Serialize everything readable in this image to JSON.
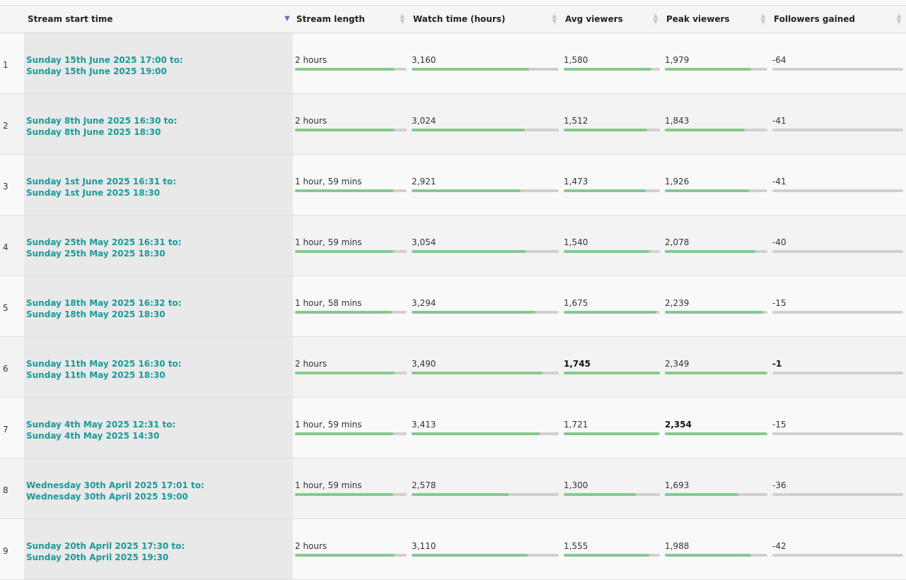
{
  "columns": [
    {
      "key": "num",
      "label": ""
    },
    {
      "key": "start",
      "label": "Stream start time",
      "sorted": true
    },
    {
      "key": "length",
      "label": "Stream length"
    },
    {
      "key": "watch",
      "label": "Watch time (hours)"
    },
    {
      "key": "avg",
      "label": "Avg viewers"
    },
    {
      "key": "peak",
      "label": "Peak viewers"
    },
    {
      "key": "followers",
      "label": "Followers gained"
    }
  ],
  "colors": {
    "link": "#1a9a9a",
    "bar_fill": "#86c98e",
    "bar_track": "#d0d0d0",
    "sort_active": "#6d6fb5"
  },
  "rows": [
    {
      "num": "1",
      "start_line1": "Sunday 15th June 2025 17:00 to:",
      "start_line2": "Sunday 15th June 2025 19:00",
      "length": "2 hours",
      "length_frac": 0.89,
      "watch": "3,160",
      "watch_frac": 0.8,
      "avg": "1,580",
      "avg_frac": 0.91,
      "peak": "1,979",
      "peak_frac": 0.84,
      "followers": "-64",
      "followers_frac": 0
    },
    {
      "num": "2",
      "start_line1": "Sunday 8th June 2025 16:30 to:",
      "start_line2": "Sunday 8th June 2025 18:30",
      "length": "2 hours",
      "length_frac": 0.89,
      "watch": "3,024",
      "watch_frac": 0.77,
      "avg": "1,512",
      "avg_frac": 0.87,
      "peak": "1,843",
      "peak_frac": 0.78,
      "followers": "-41",
      "followers_frac": 0
    },
    {
      "num": "3",
      "start_line1": "Sunday 1st June 2025 16:31 to:",
      "start_line2": "Sunday 1st June 2025 18:30",
      "length": "1 hour, 59 mins",
      "length_frac": 0.88,
      "watch": "2,921",
      "watch_frac": 0.74,
      "avg": "1,473",
      "avg_frac": 0.85,
      "peak": "1,926",
      "peak_frac": 0.82,
      "followers": "-41",
      "followers_frac": 0
    },
    {
      "num": "4",
      "start_line1": "Sunday 25th May 2025 16:31 to:",
      "start_line2": "Sunday 25th May 2025 18:30",
      "length": "1 hour, 59 mins",
      "length_frac": 0.88,
      "watch": "3,054",
      "watch_frac": 0.78,
      "avg": "1,540",
      "avg_frac": 0.89,
      "peak": "2,078",
      "peak_frac": 0.88,
      "followers": "-40",
      "followers_frac": 0
    },
    {
      "num": "5",
      "start_line1": "Sunday 18th May 2025 16:32 to:",
      "start_line2": "Sunday 18th May 2025 18:30",
      "length": "1 hour, 58 mins",
      "length_frac": 0.87,
      "watch": "3,294",
      "watch_frac": 0.84,
      "avg": "1,675",
      "avg_frac": 0.96,
      "peak": "2,239",
      "peak_frac": 0.95,
      "followers": "-15",
      "followers_frac": 0
    },
    {
      "num": "6",
      "start_line1": "Sunday 11th May 2025 16:30 to:",
      "start_line2": "Sunday 11th May 2025 18:30",
      "length": "2 hours",
      "length_frac": 0.89,
      "watch": "3,490",
      "watch_frac": 0.89,
      "avg": "1,745",
      "avg_frac": 1.0,
      "avg_bold": true,
      "peak": "2,349",
      "peak_frac": 1.0,
      "followers": "-1",
      "followers_frac": 0,
      "followers_bold": true
    },
    {
      "num": "7",
      "start_line1": "Sunday 4th May 2025 12:31 to:",
      "start_line2": "Sunday 4th May 2025 14:30",
      "length": "1 hour, 59 mins",
      "length_frac": 0.88,
      "watch": "3,413",
      "watch_frac": 0.87,
      "avg": "1,721",
      "avg_frac": 0.99,
      "peak": "2,354",
      "peak_frac": 1.0,
      "peak_bold": true,
      "followers": "-15",
      "followers_frac": 0
    },
    {
      "num": "8",
      "start_line1": "Wednesday 30th April 2025 17:01 to:",
      "start_line2": "Wednesday 30th April 2025 19:00",
      "length": "1 hour, 59 mins",
      "length_frac": 0.88,
      "watch": "2,578",
      "watch_frac": 0.66,
      "avg": "1,300",
      "avg_frac": 0.75,
      "peak": "1,693",
      "peak_frac": 0.72,
      "followers": "-36",
      "followers_frac": 0
    },
    {
      "num": "9",
      "start_line1": "Sunday 20th April 2025 17:30 to:",
      "start_line2": "Sunday 20th April 2025 19:30",
      "length": "2 hours",
      "length_frac": 0.89,
      "watch": "3,110",
      "watch_frac": 0.79,
      "avg": "1,555",
      "avg_frac": 0.89,
      "peak": "1,988",
      "peak_frac": 0.84,
      "followers": "-42",
      "followers_frac": 0
    }
  ]
}
